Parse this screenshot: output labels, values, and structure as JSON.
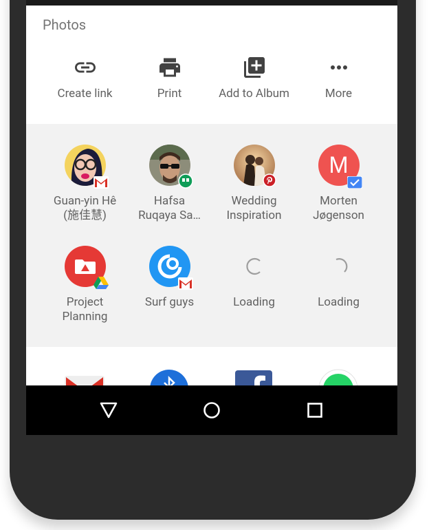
{
  "share_sheet": {
    "title": "Photos",
    "actions": [
      {
        "label": "Create link",
        "icon": "link-icon"
      },
      {
        "label": "Print",
        "icon": "print-icon"
      },
      {
        "label": "Add to Album",
        "icon": "add-to-album-icon"
      },
      {
        "label": "More",
        "icon": "more-horiz-icon"
      }
    ]
  },
  "contacts": [
    {
      "name_line1": "Guan-yin Hê",
      "name_line2": "(施佳慧)",
      "app_badge": "gmail"
    },
    {
      "name_line1": "Hafsa",
      "name_line2": "Ruqaya Sa…",
      "app_badge": "hangouts"
    },
    {
      "name_line1": "Wedding",
      "name_line2": "Inspiration",
      "app_badge": "pinterest"
    },
    {
      "name_line1": "Morten",
      "name_line2": "Jøgenson",
      "app_badge": "inbox",
      "avatar_letter": "M"
    },
    {
      "name_line1": "Project",
      "name_line2": "Planning",
      "app_badge": "drive"
    },
    {
      "name_line1": "Surf guys",
      "name_line2": "",
      "app_badge": "gmail"
    },
    {
      "name_line1": "Loading",
      "name_line2": "",
      "state": "loading"
    },
    {
      "name_line1": "Loading",
      "name_line2": "",
      "state": "loading"
    }
  ],
  "apps": [
    "gmail",
    "bluetooth",
    "facebook",
    "whatsapp"
  ],
  "navigation": [
    "back",
    "home",
    "recents"
  ],
  "colors": {
    "accent_red": "#ef5350",
    "folder_red": "#e53935",
    "group_blue": "#2196f3",
    "contacts_bg": "#f2f2f2",
    "nav_bg": "#000000"
  }
}
